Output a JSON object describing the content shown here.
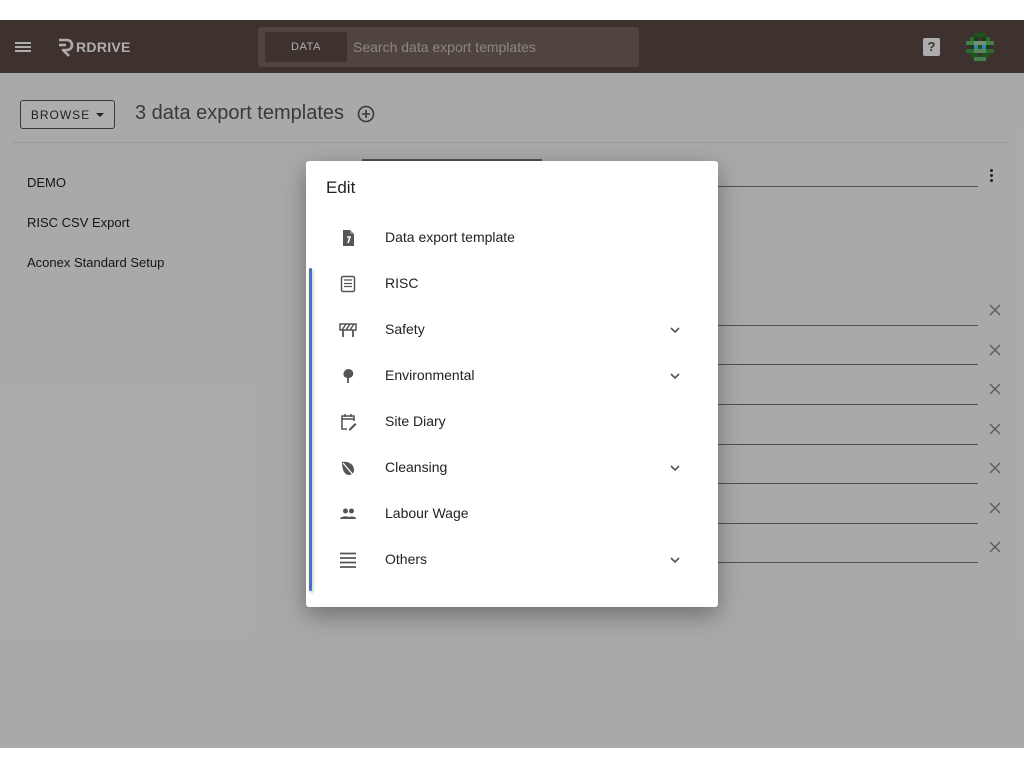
{
  "brand": {
    "name": "RDRIVE"
  },
  "search": {
    "chip_label": "DATA",
    "placeholder": "Search data export templates"
  },
  "header": {
    "help_label": "?"
  },
  "toolbar": {
    "browse_label": "BROWSE",
    "count_title": "3 data export templates"
  },
  "templates": [
    "DEMO",
    "RISC CSV Export",
    "Aconex Standard Setup"
  ],
  "dialog": {
    "title": "Edit",
    "items": [
      {
        "label": "Data export template",
        "icon": "file-export-icon",
        "expandable": false
      },
      {
        "label": "RISC",
        "icon": "form-icon",
        "expandable": false
      },
      {
        "label": "Safety",
        "icon": "barrier-icon",
        "expandable": true
      },
      {
        "label": "Environmental",
        "icon": "tree-icon",
        "expandable": true
      },
      {
        "label": "Site Diary",
        "icon": "calendar-edit-icon",
        "expandable": false
      },
      {
        "label": "Cleansing",
        "icon": "leaf-icon",
        "expandable": true
      },
      {
        "label": "Labour Wage",
        "icon": "people-icon",
        "expandable": false
      },
      {
        "label": "Others",
        "icon": "list-icon",
        "expandable": true
      }
    ]
  },
  "colors": {
    "topbar": "#5a4a44",
    "search_bg": "#75655f",
    "accent": "#3b74d6"
  }
}
